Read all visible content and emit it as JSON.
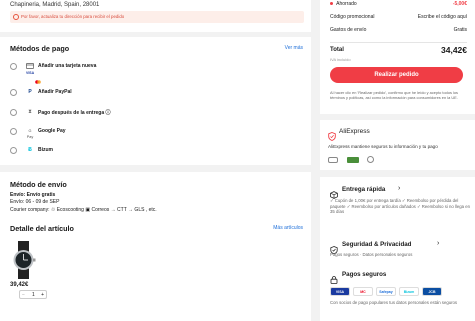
{
  "address": {
    "text": "Chapineria, Madrid, Spain, 28001",
    "warning": "Por favor, actualiza tu dirección para recibir el pedido"
  },
  "payment": {
    "title": "Métodos de pago",
    "more": "Ver más",
    "methods": [
      {
        "label": "Añadir una tarjeta nueva",
        "icon": "credit-card-icon"
      },
      {
        "label": "Añadir PayPal",
        "icon": "paypal-icon"
      },
      {
        "label": "Pago después de la entrega ⓘ",
        "icon": "clock-icon"
      },
      {
        "label": "Google Pay",
        "icon": "google-pay-icon"
      },
      {
        "label": "Bizum",
        "icon": "bizum-icon"
      }
    ],
    "card_brands": [
      "VISA",
      "MC"
    ]
  },
  "shipping": {
    "title": "Método de envío",
    "line1": "Envío: Envío gratis",
    "line2": "Envío: 06 - 09 de SEP",
    "line3": "Courier company: ♲ Ecoscooting ▣ Correos → CTT → GLS , etc."
  },
  "item": {
    "title": "Detalle del artículo",
    "more": "Más artículos",
    "price": "39,42€",
    "qty": "1",
    "minus": "−",
    "plus": "+"
  },
  "summary": {
    "ahorrado_label": "Ahorrado",
    "ahorrado_value": "-5,00€",
    "promo_label": "Código promocional",
    "promo_value": "Escribe el código aquí",
    "shipping_label": "Gastos de envío",
    "shipping_value": "Gratis",
    "total_label": "Total",
    "total_value": "34,42€",
    "iva": "IVA incluido",
    "button": "Realizar pedido",
    "legal": "Al hacer clic en 'Realizar pedido', confirmo que he leído y acepto todos los términos y políticas, así como la información para consumidores en la UE."
  },
  "trust": {
    "brand": "AliExpress",
    "text": "AliExpress mantiene seguros tu información y tu pago"
  },
  "features": {
    "delivery_title": "Entrega rápida",
    "delivery_text": "✓ Cupón de 1,00€ por entrega tardía   ✓ Reembolso por pérdida del paquete   ✓ Reembolso por artículos dañados   ✓ Reembolso si no llega en 35 días",
    "security_title": "Seguridad & Privacidad",
    "security_text": "Pagos seguros · Datos personales seguros",
    "payments_title": "Pagos seguros",
    "payments_text": "Con socios de pago populares tus datos personales están seguros",
    "pay_logos": [
      "VISA",
      "MC",
      "Safepay",
      "Bizum",
      "JCB"
    ]
  },
  "colors": {
    "accent": "#f03d45",
    "link": "#1e6fd9"
  }
}
